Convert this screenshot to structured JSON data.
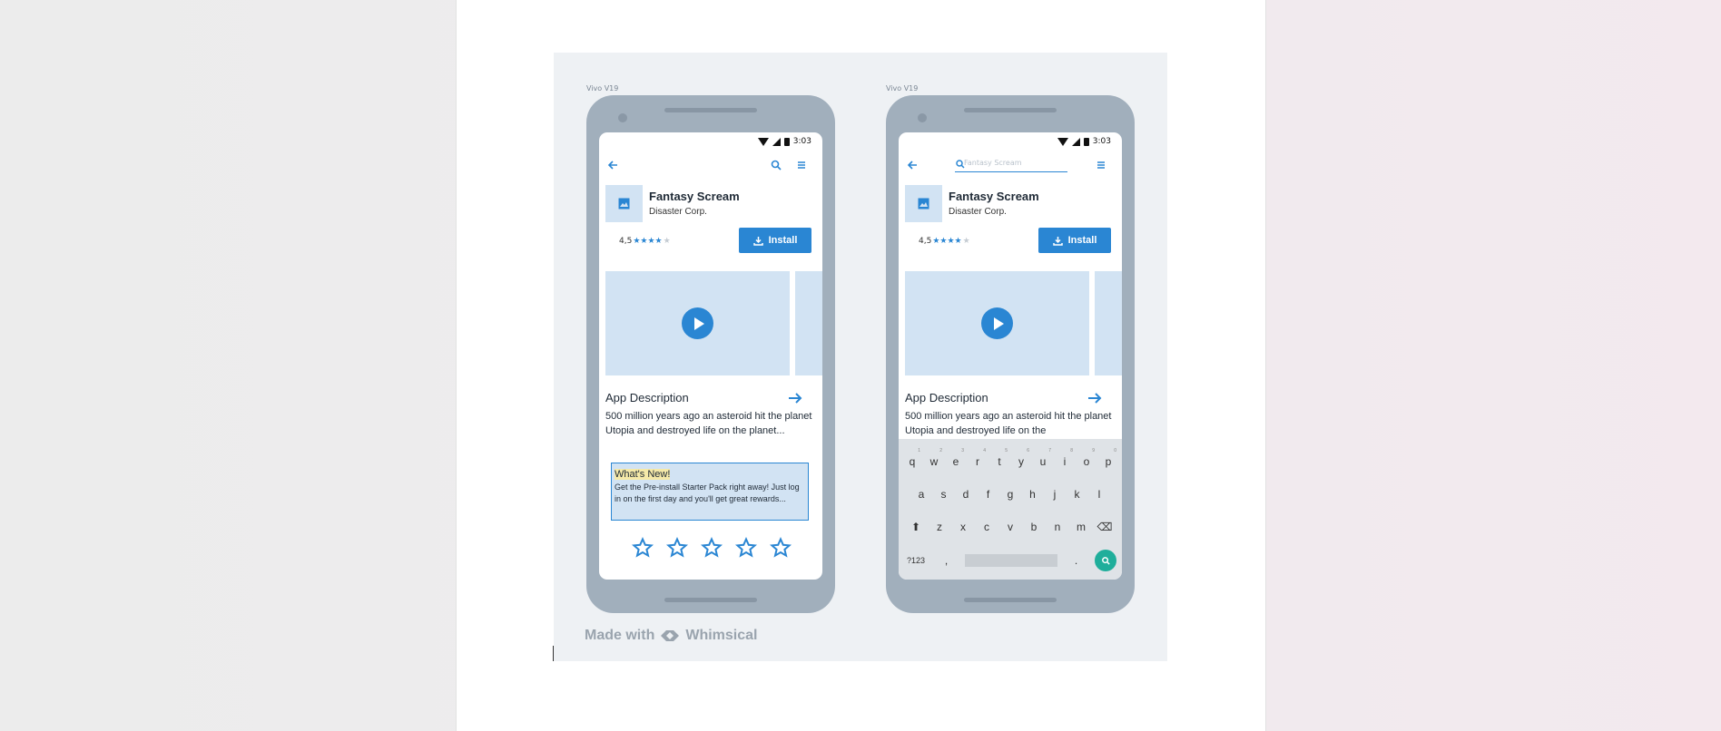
{
  "phones": [
    {
      "label": "Vivo V19",
      "time": "3:03",
      "app_name": "Fantasy Scream",
      "developer": "Disaster Corp.",
      "rating": "4,5",
      "install_label": "Install",
      "description_title": "App Description",
      "description_text": "500 million years ago an asteroid hit the planet Utopia and destroyed life on the planet...",
      "whats_new_title": "What's New!",
      "whats_new_text": "Get the Pre-install Starter Pack right away! Just log in on the first day and you'll get great rewards..."
    },
    {
      "label": "Vivo V19",
      "time": "3:03",
      "search_placeholder": "Fantasy Scream",
      "app_name": "Fantasy Scream",
      "developer": "Disaster Corp.",
      "rating": "4,5",
      "install_label": "Install",
      "description_title": "App Description",
      "description_text": "500 million years ago an asteroid hit the planet Utopia and destroyed life on the",
      "keyboard": {
        "row1": [
          "q",
          "w",
          "e",
          "r",
          "t",
          "y",
          "u",
          "i",
          "o",
          "p"
        ],
        "row1_hints": [
          "1",
          "2",
          "3",
          "4",
          "5",
          "6",
          "7",
          "8",
          "9",
          "0"
        ],
        "row2": [
          "a",
          "s",
          "d",
          "f",
          "g",
          "h",
          "j",
          "k",
          "l"
        ],
        "row3": [
          "z",
          "x",
          "c",
          "v",
          "b",
          "n",
          "m"
        ],
        "symbols_key": "?123",
        "comma_key": ",",
        "period_key": "."
      }
    }
  ],
  "footer": {
    "made_with": "Made with",
    "brand": "Whimsical"
  },
  "colors": {
    "accent": "#2a86d3",
    "device": "#a1afbc",
    "media": "#d2e3f3",
    "highlight": "#f5e9a8",
    "search_key": "#1fae9b"
  }
}
